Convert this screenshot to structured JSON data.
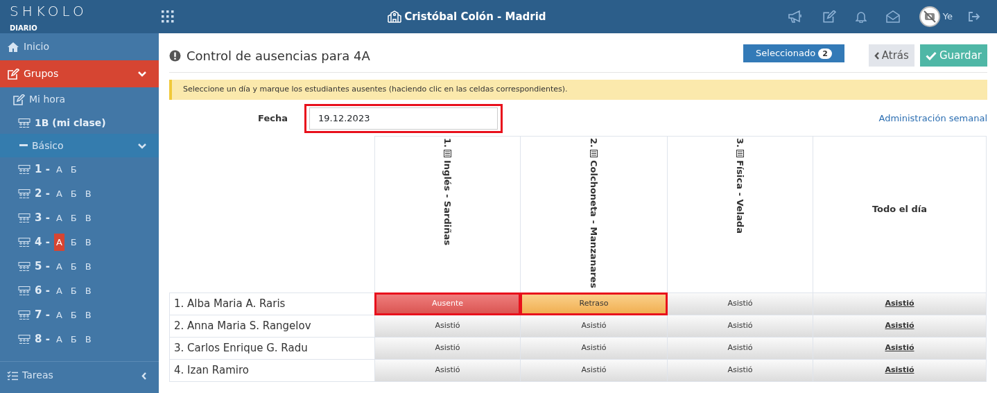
{
  "brand": {
    "logo": "SHKOLO",
    "subtitle": "DIARIO"
  },
  "school": "Cristóbal Colón - Madrid",
  "user": {
    "name": "Ye"
  },
  "sidebar": {
    "items": [
      {
        "label": "Inicio",
        "kind": "link",
        "selected": false
      },
      {
        "label": "Grupos",
        "kind": "section",
        "selected": true,
        "expanded": true
      },
      {
        "label": "Mi hora",
        "kind": "sub",
        "selected": false
      },
      {
        "label": "1B (mi clase)",
        "kind": "class",
        "selected": false
      },
      {
        "label": "Básico",
        "kind": "group",
        "selected": false,
        "expanded": true
      }
    ],
    "grades": [
      {
        "number": "1 -",
        "letters": [
          {
            "label": "А",
            "selected": false
          },
          {
            "label": "Б",
            "selected": false
          }
        ]
      },
      {
        "number": "2 -",
        "letters": [
          {
            "label": "А",
            "selected": false
          },
          {
            "label": "Б",
            "selected": false
          },
          {
            "label": "В",
            "selected": false
          }
        ]
      },
      {
        "number": "3 -",
        "letters": [
          {
            "label": "А",
            "selected": false
          },
          {
            "label": "Б",
            "selected": false
          },
          {
            "label": "В",
            "selected": false
          }
        ]
      },
      {
        "number": "4 -",
        "letters": [
          {
            "label": "А",
            "selected": true
          },
          {
            "label": "Б",
            "selected": false
          },
          {
            "label": "В",
            "selected": false
          }
        ]
      },
      {
        "number": "5 -",
        "letters": [
          {
            "label": "А",
            "selected": false
          },
          {
            "label": "Б",
            "selected": false
          },
          {
            "label": "В",
            "selected": false
          }
        ]
      },
      {
        "number": "6 -",
        "letters": [
          {
            "label": "А",
            "selected": false
          },
          {
            "label": "Б",
            "selected": false
          },
          {
            "label": "В",
            "selected": false
          }
        ]
      },
      {
        "number": "7 -",
        "letters": [
          {
            "label": "А",
            "selected": false
          },
          {
            "label": "Б",
            "selected": false
          },
          {
            "label": "В",
            "selected": false
          }
        ]
      },
      {
        "number": "8 -",
        "letters": [
          {
            "label": "А",
            "selected": false
          },
          {
            "label": "Б",
            "selected": false
          },
          {
            "label": "В",
            "selected": false
          }
        ]
      }
    ],
    "footer_item": {
      "label": "Tareas",
      "expanded": false
    }
  },
  "page": {
    "title": "Control de ausencias para 4A",
    "selected_label": "Seleccionado",
    "selected_count": "2",
    "back": "Atrás",
    "save": "Guardar",
    "notice": "Seleccione un día y marque los estudiantes ausentes (haciendo clic en las celdas correspondientes).",
    "date_label": "Fecha",
    "date_value": "19.12.2023",
    "date_highlighted": true,
    "weekly_link": "Administración semanal"
  },
  "table": {
    "columns": [
      {
        "label": "1. ",
        "subject": "Inglés - Sardiñas",
        "kind": "lesson"
      },
      {
        "label": "2. ",
        "subject": "Colchoneta - Manzanares",
        "kind": "lesson"
      },
      {
        "label": "3. ",
        "subject": "Física - Velada",
        "kind": "lesson"
      },
      {
        "label": "Todo el día",
        "kind": "day"
      }
    ],
    "rows": [
      {
        "student": "1. Alba Maria A. Raris",
        "cells": [
          {
            "text": "Ausente",
            "kind": "absent",
            "highlighted": true
          },
          {
            "text": "Retraso",
            "kind": "late",
            "highlighted": true
          },
          {
            "text": "Asistió",
            "kind": "present",
            "highlighted": false
          },
          {
            "text": "Asistió",
            "kind": "present",
            "highlighted": false
          }
        ]
      },
      {
        "student": "2. Anna Maria S. Rangelov",
        "cells": [
          {
            "text": "Asistió",
            "kind": "present",
            "highlighted": false
          },
          {
            "text": "Asistió",
            "kind": "present",
            "highlighted": false
          },
          {
            "text": "Asistió",
            "kind": "present",
            "highlighted": false
          },
          {
            "text": "Asistió",
            "kind": "present",
            "highlighted": false
          }
        ]
      },
      {
        "student": "3. Carlos Enrique G. Radu",
        "cells": [
          {
            "text": "Asistió",
            "kind": "present",
            "highlighted": false
          },
          {
            "text": "Asistió",
            "kind": "present",
            "highlighted": false
          },
          {
            "text": "Asistió",
            "kind": "present",
            "highlighted": false
          },
          {
            "text": "Asistió",
            "kind": "present",
            "highlighted": false
          }
        ]
      },
      {
        "student": "4. Izan Ramiro",
        "cells": [
          {
            "text": "Asistió",
            "kind": "present",
            "highlighted": false
          },
          {
            "text": "Asistió",
            "kind": "present",
            "highlighted": false
          },
          {
            "text": "Asistió",
            "kind": "present",
            "highlighted": false
          },
          {
            "text": "Asistió",
            "kind": "present",
            "highlighted": false
          }
        ]
      }
    ]
  }
}
